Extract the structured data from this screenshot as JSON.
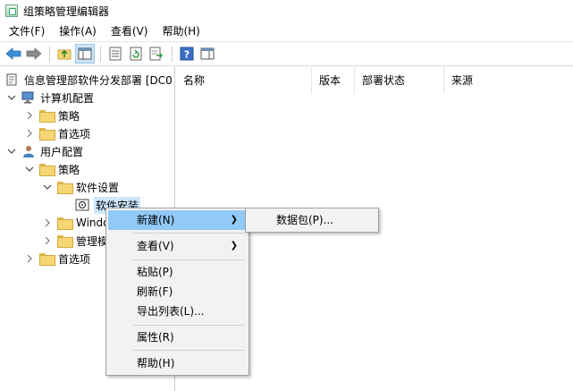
{
  "window": {
    "title": "组策略管理编辑器"
  },
  "menubar": [
    {
      "label": "文件(F)"
    },
    {
      "label": "操作(A)"
    },
    {
      "label": "查看(V)"
    },
    {
      "label": "帮助(H)"
    }
  ],
  "toolbar": {
    "icons": [
      "back-arrow-icon",
      "forward-arrow-icon",
      "up-folder-icon",
      "show-hide-tree-icon",
      "properties-icon",
      "refresh-icon",
      "export-list-icon",
      "help-icon",
      "show-hide-action-pane-icon"
    ]
  },
  "tree": {
    "root": "信息管理部软件分发部署 [DC0",
    "computer_config": "计算机配置",
    "cc_policies": "策略",
    "cc_preferences": "首选项",
    "user_config": "用户配置",
    "uc_policies": "策略",
    "software_settings": "软件设置",
    "software_installation": "软件安装",
    "windows_settings": "Windo",
    "admin_templates": "管理模",
    "uc_preferences": "首选项"
  },
  "list": {
    "columns": [
      "名称",
      "版本",
      "部署状态",
      "来源"
    ]
  },
  "context_menu": {
    "new": "新建(N)",
    "view": "查看(V)",
    "paste": "粘贴(P)",
    "refresh": "刷新(F)",
    "export_list": "导出列表(L)...",
    "properties": "属性(R)",
    "help": "帮助(H)"
  },
  "submenu": {
    "package": "数据包(P)..."
  },
  "colors": {
    "menu_highlight": "#91c9f7",
    "selection": "#cce8ff",
    "folder": "#f6d674"
  }
}
